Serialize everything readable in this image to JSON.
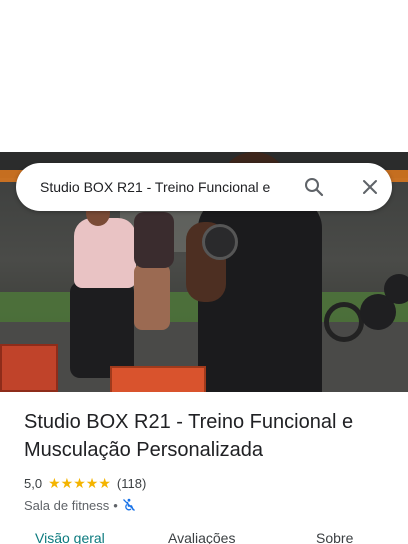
{
  "search": {
    "query": "Studio BOX R21 - Treino Funcional e",
    "search_icon": "search-icon",
    "close_icon": "close-icon"
  },
  "place": {
    "name": "Studio BOX R21 - Treino Funcional e Musculação Personalizada",
    "rating_value": "5,0",
    "rating_stars": 5,
    "review_count": "(118)",
    "category": "Sala de fitness",
    "separator": "•",
    "accessibility_icon": "not-accessible-icon"
  },
  "tabs": [
    {
      "label": "Visão geral",
      "active": true
    },
    {
      "label": "Avaliações",
      "active": false
    },
    {
      "label": "Sobre",
      "active": false
    }
  ],
  "colors": {
    "active_tab": "#0b7a7e",
    "star": "#f4b400",
    "accessibility_icon": "#1a73e8"
  }
}
